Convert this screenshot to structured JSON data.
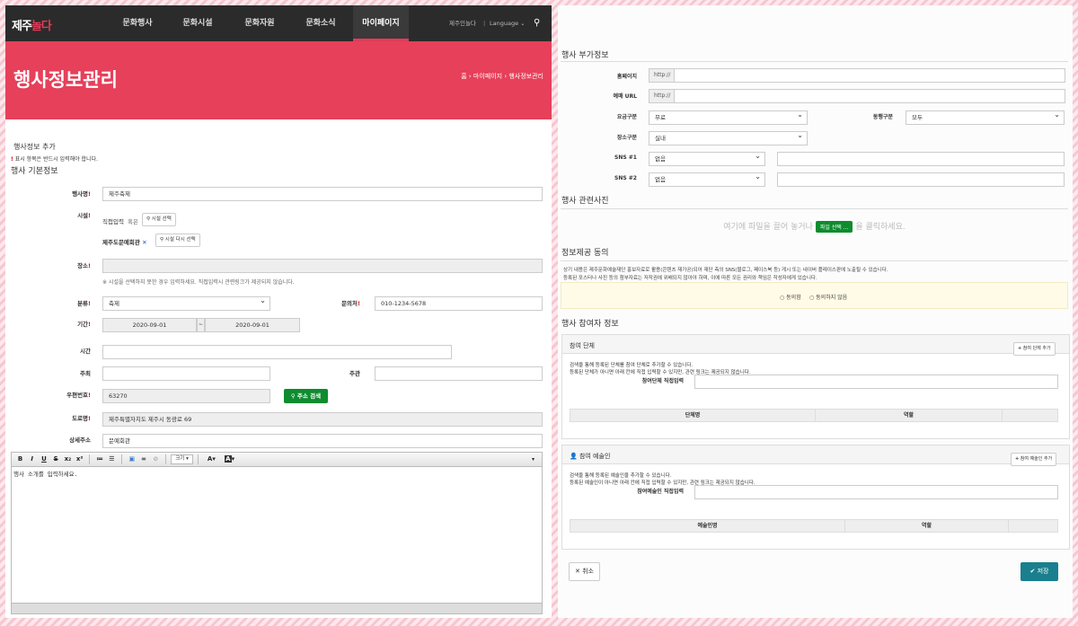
{
  "nav": {
    "logo_main": "제주",
    "logo_accent": "놀다",
    "items": [
      "문화행사",
      "문화시설",
      "문화자원",
      "문화소식",
      "마이페이지"
    ],
    "user": "제주인놀다",
    "language": "Language"
  },
  "hero": {
    "title": "행사정보관리",
    "breadcrumb": "홈 › 마이페이지 › 행사정보관리"
  },
  "form": {
    "add_title": "행사정보 추가",
    "required_note": "표시 항목은 반드시 입력해야 합니다.",
    "basic_title": "행사 기본정보",
    "event_name_label": "행사명",
    "event_name_value": "제주축제",
    "facility_label": "시설",
    "facility_direct": "직접입력",
    "facility_or": "혹은",
    "facility_select_btn": "시설 선택",
    "facility_selected": "제주도문예회관",
    "facility_reselect_btn": "시설 다시 선택",
    "place_label": "장소",
    "place_note": "※ 시설을 선택하지 못한 경우 입력하세요. 직접입력시 관련링크가 제공되지 않습니다.",
    "category_label": "분류",
    "category_value": "축제",
    "contact_label": "문의처",
    "contact_value": "010-1234-5678",
    "period_label": "기간",
    "period_start": "2020-09-01",
    "period_sep": "~",
    "period_end": "2020-09-01",
    "time_label": "시간",
    "host_label": "주최",
    "organizer_label": "주관",
    "zip_label": "우편번호",
    "zip_value": "63270",
    "zip_btn": "주소 검색",
    "road_label": "도로명",
    "road_value": "제주특별자치도 제주시 동광로 69",
    "detail_label": "상세주소",
    "detail_value": "문예회관",
    "editor_font_size": "크기",
    "editor_placeholder": "행사 소개를 입력하세요."
  },
  "extra": {
    "title": "행사 부가정보",
    "homepage_label": "홈페이지",
    "ticket_label": "예매 URL",
    "url_prefix": "http://",
    "fee_label": "요금구분",
    "fee_value": "무료",
    "companion_label": "동행구분",
    "companion_value": "모두",
    "place_type_label": "장소구분",
    "place_type_value": "실내",
    "sns1_label": "SNS #1",
    "sns1_value": "없음",
    "sns2_label": "SNS #2",
    "sns2_value": "없음"
  },
  "photos": {
    "title": "행사 관련사진",
    "drop_text_a": "여기에 파일을 끌어 놓거나",
    "drop_btn": "파일 선택 ...",
    "drop_text_b": "을 클릭하세요."
  },
  "consent": {
    "title": "정보제공 동의",
    "line1": "상기 내용은 제주문화예술재단 홍보자료로 활용(콘텐츠 재가공)되어 재단 측의 SNS(블로그, 페이스북 등) 게시 또는 네이버 플레이스판에 노출될 수 있습니다.",
    "line2": "등록된 포스터나 사진 등의 첨부자료는 저작권에 위배되지 않아야 하며, 이에 따른 모든 권리와 책임은 작성자에게 있습니다.",
    "agree": "동의함",
    "disagree": "동의하지 않음"
  },
  "participants": {
    "title": "행사 참여자 정보",
    "group_title": "참여 단체",
    "group_add": "참여 단체 추가",
    "group_note1": "검색을 통해 등록된 단체를 참여 단체로 추가할 수 있습니다.",
    "group_note2": "등록된 단체가 아니면 아래 칸에 직접 입력할 수 있지만, 관련 링크는 제공되지 않습니다.",
    "group_direct_label": "참여단체 직접입력",
    "group_col1": "단체명",
    "group_col2": "역할",
    "artist_title": "참여 예술인",
    "artist_add": "참여 예술인 추가",
    "artist_note1": "검색을 통해 등록된 예술인을 추가할 수 있습니다.",
    "artist_note2": "등록된 예술인이 아니면 아래 칸에 직접 입력할 수 있지만, 관련 링크는 제공되지 않습니다.",
    "artist_direct_label": "참여예술인 직접입력",
    "artist_col1": "예술인명",
    "artist_col2": "역할"
  },
  "actions": {
    "cancel": "취소",
    "save": "저장"
  },
  "colors": {
    "brand": "#e6405a",
    "green": "#0e8c2e",
    "teal": "#1a7f8e"
  }
}
